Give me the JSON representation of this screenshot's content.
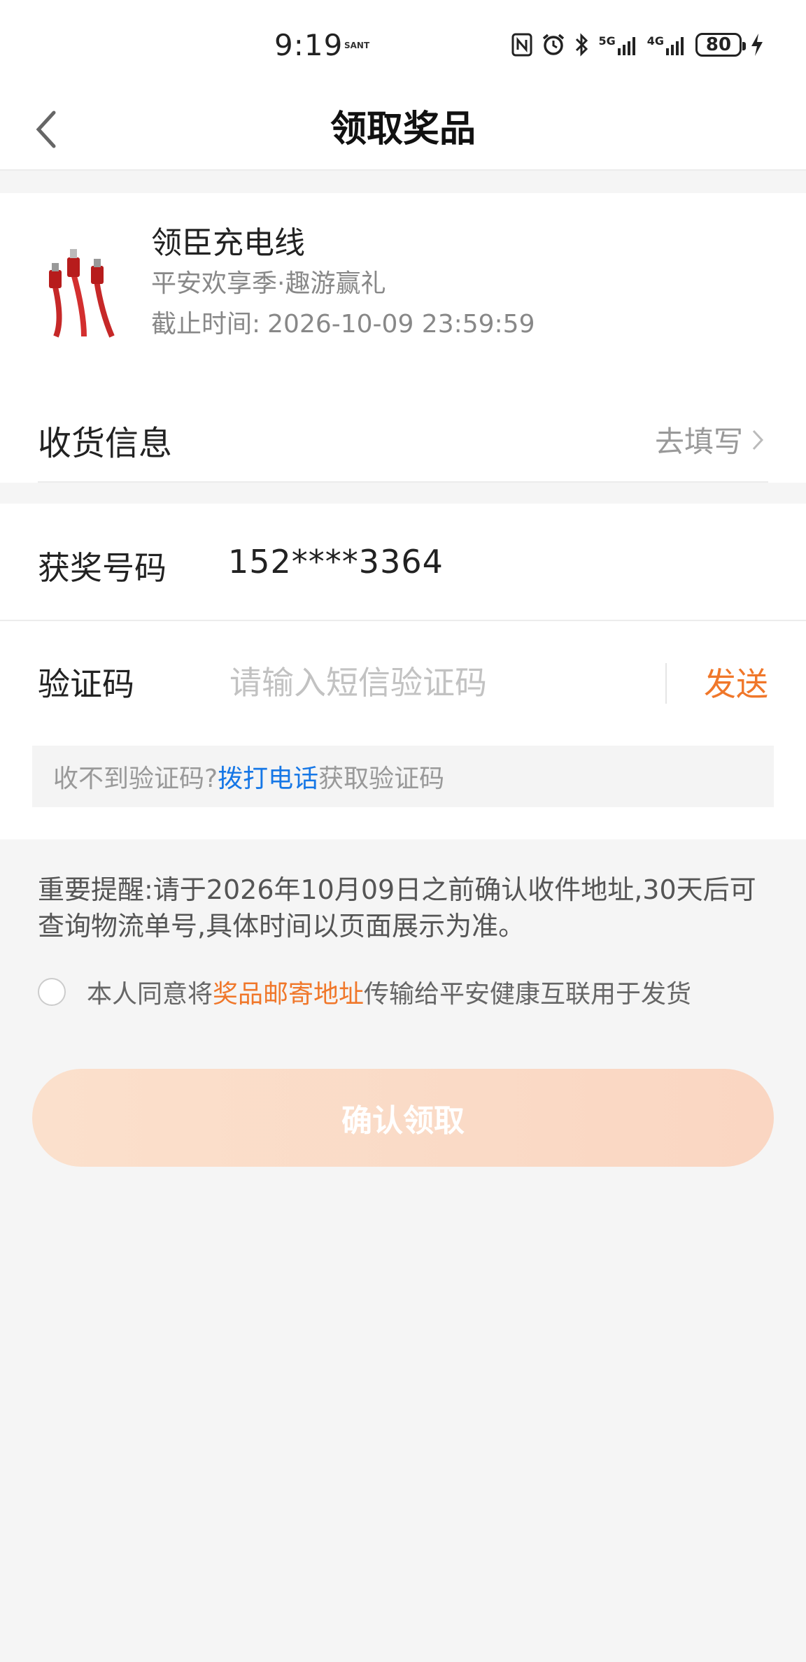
{
  "status_bar": {
    "time": "9:19",
    "carrier_tag": "SANT",
    "signal_5g": "5G",
    "signal_4g": "4G",
    "battery": "80"
  },
  "header": {
    "title": "领取奖品"
  },
  "prize": {
    "name": "领臣充电线",
    "campaign": "平安欢享季·趣游赢礼",
    "deadline_label": "截止时间:",
    "deadline_value": "2026-10-09 23:59:59"
  },
  "shipping": {
    "label": "收货信息",
    "action": "去填写"
  },
  "phone": {
    "label": "获奖号码",
    "value": "152****3364"
  },
  "verify": {
    "label": "验证码",
    "placeholder": "请输入短信验证码",
    "send_label": "发送"
  },
  "hint": {
    "prefix": "收不到验证码?",
    "link": "拨打电话",
    "suffix": "获取验证码"
  },
  "notice": {
    "text": "重要提醒:请于2026年10月09日之前确认收件地址,30天后可查询物流单号,具体时间以页面展示为准。"
  },
  "agreement": {
    "prefix": "本人同意将",
    "link": "奖品邮寄地址",
    "suffix": "传输给平安健康互联用于发货"
  },
  "confirm": {
    "label": "确认领取"
  },
  "colors": {
    "accent_orange": "#f0772a",
    "link_blue": "#1677e6",
    "button_disabled_start": "#fbe0cc",
    "button_disabled_end": "#fad6c2"
  }
}
